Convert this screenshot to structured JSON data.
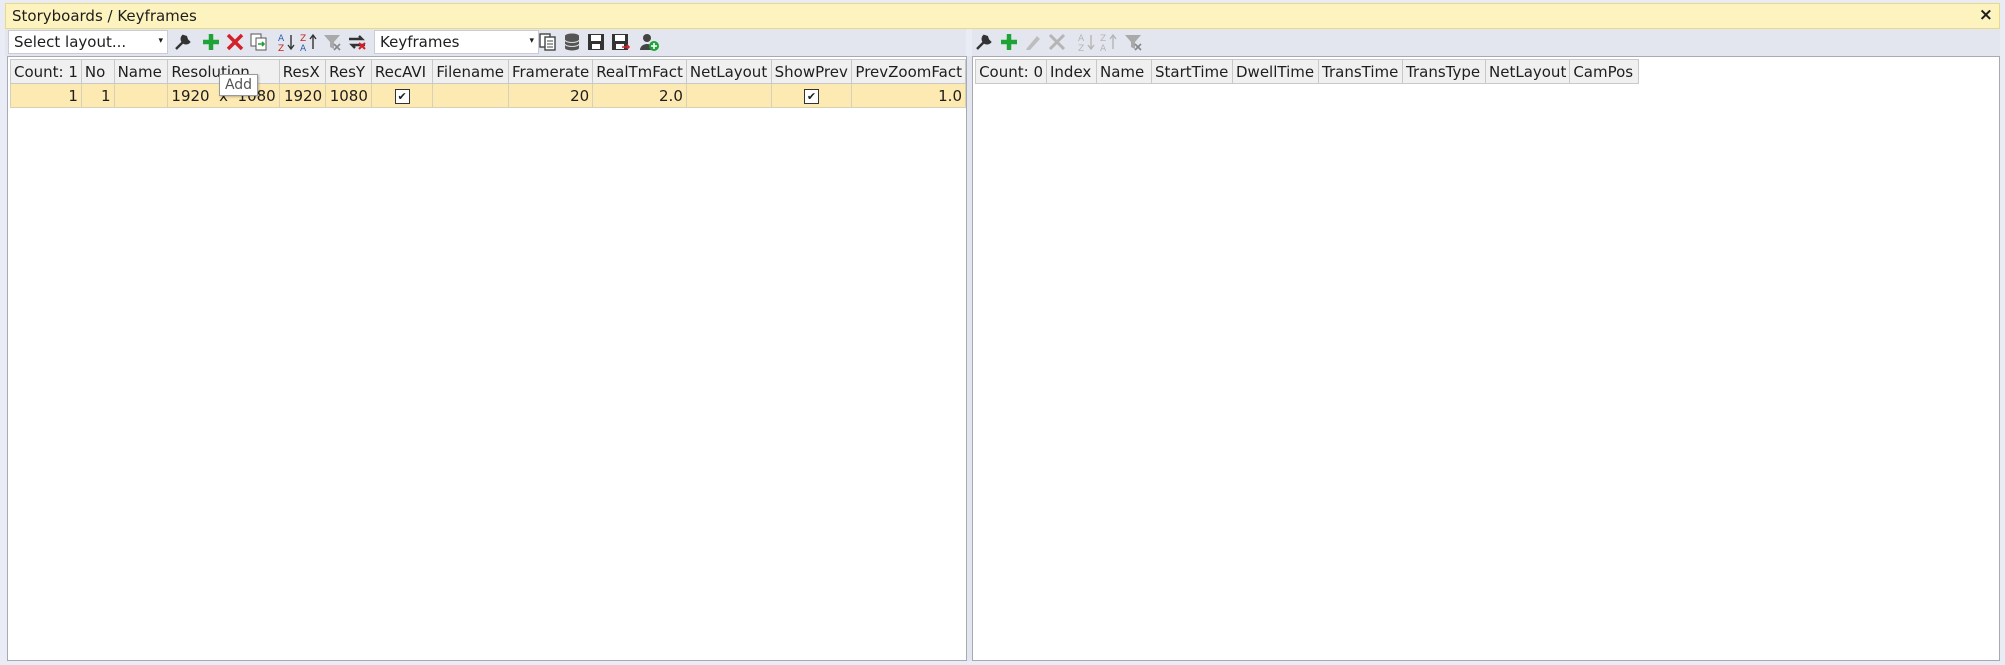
{
  "window": {
    "title": "Storyboards / Keyframes",
    "close_symbol": "×"
  },
  "left_toolbar": {
    "layout_select": {
      "value": "Select layout...",
      "arrow": "▾"
    },
    "view_select": {
      "value": "Keyframes",
      "arrow": "▾"
    },
    "icons": [
      "wrench-icon",
      "add-icon",
      "delete-icon",
      "duplicate-icon",
      "sort-az-icon",
      "sort-za-icon",
      "filter-icon",
      "refresh-icon",
      "copy-icon",
      "database-icon",
      "save-icon",
      "save-as-icon",
      "user-add-icon"
    ]
  },
  "tooltip": {
    "text": "Add"
  },
  "storyboards": {
    "columns": [
      "Count: 1",
      "No",
      "Name",
      "Resolution",
      "ResX",
      "ResY",
      "RecAVI",
      "Filename",
      "Framerate",
      "RealTmFact",
      "NetLayout",
      "ShowPrev",
      "PrevZoomFact"
    ],
    "rows": [
      {
        "index": "1",
        "no": "1",
        "name": "",
        "resolution": "1920  x  1080",
        "resx": "1920",
        "resy": "1080",
        "recavi": true,
        "filename": "",
        "framerate": "20",
        "realtmfact": "2.0",
        "netlayout": "",
        "showprev": true,
        "prevzoomfact": "1.0"
      }
    ]
  },
  "keyframes": {
    "columns": [
      "Count: 0",
      "Index",
      "Name",
      "StartTime",
      "DwellTime",
      "TransTime",
      "TransType",
      "NetLayout",
      "CamPos"
    ],
    "rows": []
  },
  "colors": {
    "title_bg": "#fdf3bf",
    "row_bg": "#fde9b2",
    "add_green": "#1fa336",
    "delete_red": "#d4202a"
  }
}
